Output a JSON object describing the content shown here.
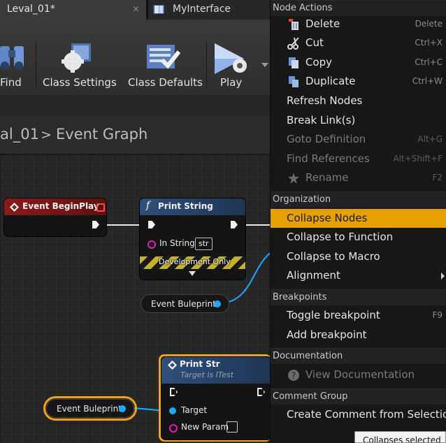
{
  "tabs": [
    {
      "label": "Leval_01*",
      "close": "×"
    },
    {
      "label": "MyInterface"
    }
  ],
  "toolbar": {
    "find_label": "Find",
    "class_settings_label": "Class Settings",
    "class_defaults_label": "Class Defaults",
    "play_label": "Play"
  },
  "breadcrumb": {
    "parent": "al_01",
    "separator": ">",
    "current": "Event Graph"
  },
  "graph": {
    "begin_play": {
      "title": "Event BeginPlay"
    },
    "print_string": {
      "title": "Print String",
      "in_string_label": "In String",
      "in_string_value": "str",
      "dev_only": "Development Only"
    },
    "event_buleprint_1": {
      "label": "Event Buleprint"
    },
    "event_buleprint_2": {
      "label": "Event Buleprint"
    },
    "print_str": {
      "title": "Print Str",
      "subtitle": "Target is ITest",
      "target_label": "Target",
      "new_param_label": "New Param"
    },
    "colors": {
      "event_red": "#8c1a1a",
      "function_blue": "#2e4f78",
      "selection_orange": "#f0a21a",
      "exec_white": "#f2f2f2",
      "interface_pin": "#1ea9ff",
      "string_pin": "#e11fb8"
    }
  },
  "menu": {
    "sections": {
      "node_actions": "Node Actions",
      "organization": "Organization",
      "breakpoints": "Breakpoints",
      "documentation": "Documentation",
      "comment_group": "Comment Group"
    },
    "delete": {
      "label": "Delete",
      "key": "Delete",
      "icon": "delete-icon"
    },
    "cut": {
      "label": "Cut",
      "key": "Ctrl+X",
      "icon": "scissors-icon"
    },
    "copy": {
      "label": "Copy",
      "key": "Ctrl+C",
      "icon": "copy-icon"
    },
    "duplicate": {
      "label": "Duplicate",
      "key": "Ctrl+W",
      "icon": "duplicate-icon"
    },
    "refresh": {
      "label": "Refresh Nodes"
    },
    "break_links": {
      "label": "Break Link(s)"
    },
    "goto_def": {
      "label": "Goto Definition",
      "key": "Alt+G"
    },
    "find_refs": {
      "label": "Find References",
      "key": "Alt+Shift+F"
    },
    "rename": {
      "label": "Rename",
      "key": "F2",
      "icon": "rename-icon"
    },
    "collapse_nodes": {
      "label": "Collapse Nodes"
    },
    "collapse_function": {
      "label": "Collapse to Function"
    },
    "collapse_macro": {
      "label": "Collapse to Macro"
    },
    "alignment": {
      "label": "Alignment"
    },
    "toggle_bp": {
      "label": "Toggle breakpoint",
      "key": "F9"
    },
    "add_bp": {
      "label": "Add breakpoint"
    },
    "view_doc": {
      "label": "View Documentation",
      "icon": "help-icon"
    },
    "create_comment": {
      "label": "Create Comment from Selection"
    },
    "highlight_color": "#e6a100"
  },
  "tooltip": {
    "text": "Collapses selected"
  }
}
